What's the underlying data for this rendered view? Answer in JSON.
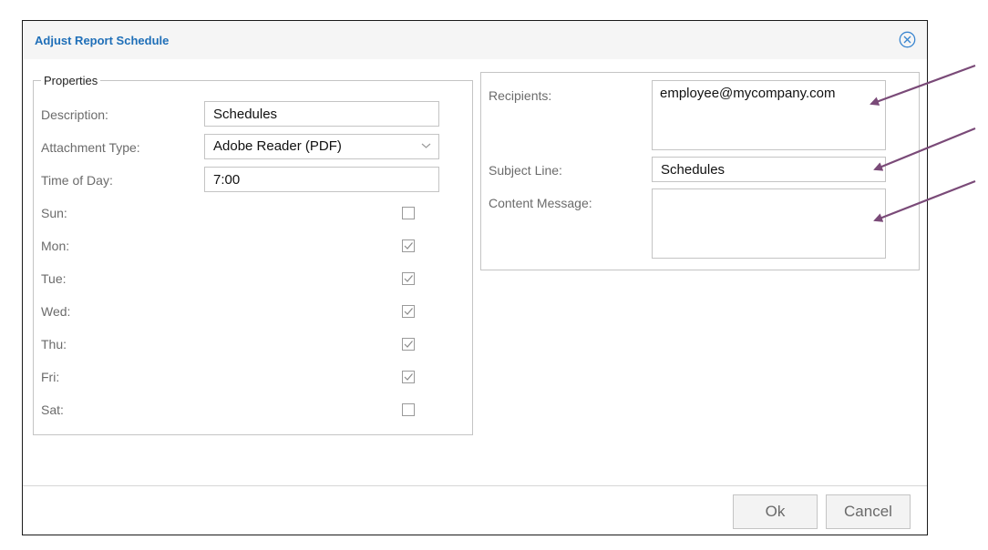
{
  "dialog": {
    "title": "Adjust Report Schedule",
    "close_icon": "circle-x-icon"
  },
  "properties": {
    "legend": "Properties",
    "description_label": "Description:",
    "description_value": "Schedules",
    "attachment_type_label": "Attachment Type:",
    "attachment_type_value": "Adobe Reader (PDF)",
    "time_of_day_label": "Time of Day:",
    "time_of_day_value": "7:00",
    "days": [
      {
        "label": "Sun:",
        "checked": false
      },
      {
        "label": "Mon:",
        "checked": true
      },
      {
        "label": "Tue:",
        "checked": true
      },
      {
        "label": "Wed:",
        "checked": true
      },
      {
        "label": "Thu:",
        "checked": true
      },
      {
        "label": "Fri:",
        "checked": true
      },
      {
        "label": "Sat:",
        "checked": false
      }
    ]
  },
  "email": {
    "recipients_label": "Recipients:",
    "recipients_value": "employee@mycompany.com",
    "subject_label": "Subject Line:",
    "subject_value": "Schedules",
    "content_label": "Content Message:",
    "content_value": ""
  },
  "footer": {
    "ok_label": "Ok",
    "cancel_label": "Cancel"
  },
  "colors": {
    "title": "#1f6fb8",
    "annotation_arrow": "#7a4a78"
  }
}
